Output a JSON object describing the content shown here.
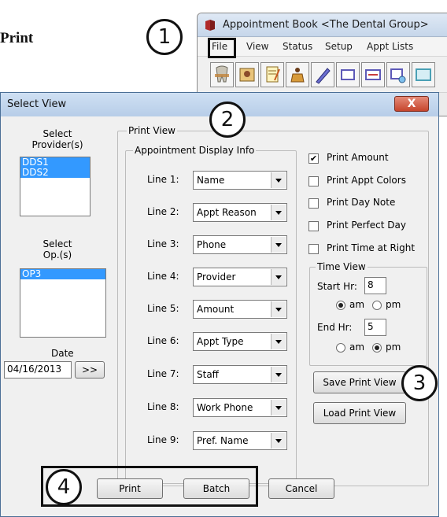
{
  "page_heading_fragment": "Print",
  "app_window": {
    "title": "Appointment Book <The Dental Group>",
    "menu": [
      "File",
      "View",
      "Status",
      "Setup",
      "Appt Lists"
    ],
    "toolbar_icons": [
      "tooth-icon",
      "photo-icon",
      "notes-icon",
      "chair-icon",
      "pen-icon",
      "rectangle-icon",
      "card-icon",
      "schedule-icon",
      "panel-icon"
    ]
  },
  "callouts": [
    "1",
    "2",
    "3",
    "4"
  ],
  "dialog": {
    "title": "Select View",
    "close_label": "X",
    "providers": {
      "label": "Select\nProvider(s)",
      "items": [
        "DDS1",
        "DDS2"
      ]
    },
    "ops": {
      "label": "Select\nOp.(s)",
      "items": [
        "OP3"
      ]
    },
    "date": {
      "label": "Date",
      "value": "04/16/2013",
      "next_label": ">>"
    },
    "print_view": {
      "label": "Print View",
      "appt_display": {
        "label": "Appointment Display Info",
        "lines": [
          {
            "label": "Line 1:",
            "value": "Name"
          },
          {
            "label": "Line 2:",
            "value": "Appt Reason"
          },
          {
            "label": "Line 3:",
            "value": "Phone"
          },
          {
            "label": "Line 4:",
            "value": "Provider"
          },
          {
            "label": "Line 5:",
            "value": "Amount"
          },
          {
            "label": "Line 6:",
            "value": "Appt Type"
          },
          {
            "label": "Line 7:",
            "value": "Staff"
          },
          {
            "label": "Line 8:",
            "value": "Work Phone"
          },
          {
            "label": "Line 9:",
            "value": "Pref. Name"
          }
        ]
      },
      "options": [
        {
          "label": "Print Amount",
          "checked": true
        },
        {
          "label": "Print Appt Colors",
          "checked": false
        },
        {
          "label": "Print Day Note",
          "checked": false
        },
        {
          "label": "Print Perfect Day",
          "checked": false
        },
        {
          "label": "Print Time at Right",
          "checked": false
        }
      ],
      "time_view": {
        "label": "Time View",
        "start_label": "Start Hr:",
        "start_value": "8",
        "start_am_label": "am",
        "start_pm_label": "pm",
        "start_selected": "am",
        "end_label": "End Hr:",
        "end_value": "5",
        "end_am_label": "am",
        "end_pm_label": "pm",
        "end_selected": "pm"
      },
      "save_button": "Save Print View",
      "load_button": "Load Print View"
    },
    "buttons": {
      "print": "Print",
      "batch": "Batch",
      "cancel": "Cancel"
    }
  }
}
